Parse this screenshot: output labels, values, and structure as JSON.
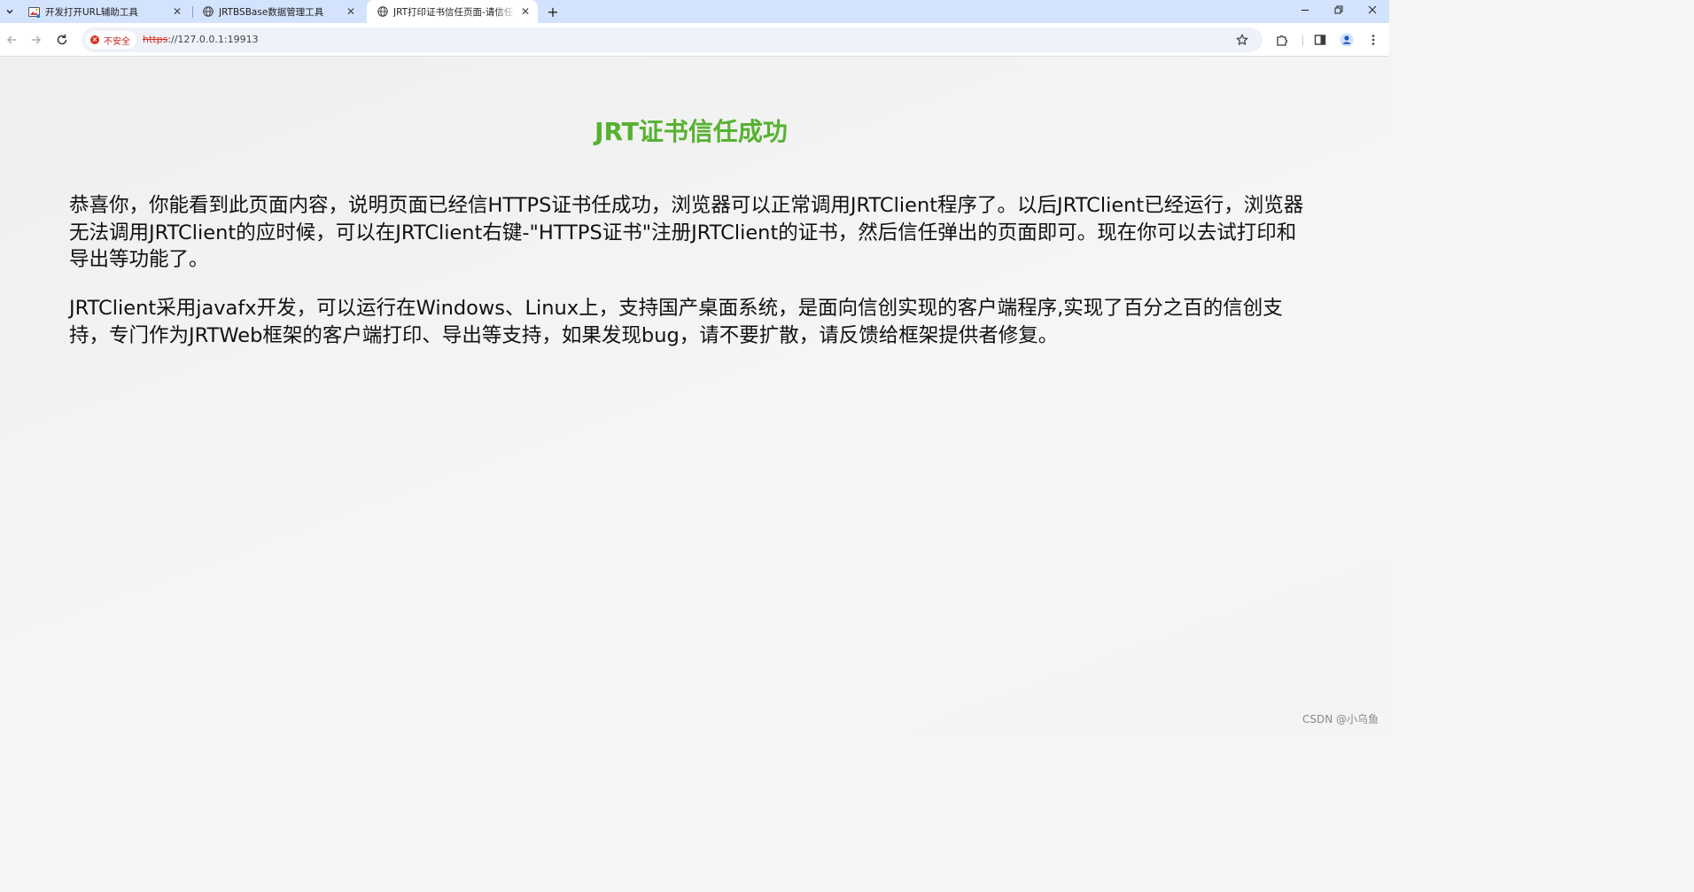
{
  "browser": {
    "tabs": [
      {
        "title": "开发打开URL辅助工具",
        "favicon": "image-icon",
        "active": false
      },
      {
        "title": "JRTBSBase数据管理工具",
        "favicon": "globe-icon",
        "active": false
      },
      {
        "title": "JRT打印证书信任页面-请信任此",
        "favicon": "globe-icon",
        "active": true
      }
    ],
    "security_label": "不安全",
    "url_scheme": "https",
    "url_rest": "://127.0.0.1:19913"
  },
  "page": {
    "title": "JRT证书信任成功",
    "paragraphs": [
      "恭喜你，你能看到此页面内容，说明页面已经信HTTPS证书任成功，浏览器可以正常调用JRTClient程序了。以后JRTClient已经运行，浏览器无法调用JRTClient的应时候，可以在JRTClient右键-\"HTTPS证书\"注册JRTClient的证书，然后信任弹出的页面即可。现在你可以去试打印和导出等功能了。",
      "JRTClient采用javafx开发，可以运行在Windows、Linux上，支持国产桌面系统，是面向信创实现的客户端程序,实现了百分之百的信创支持，专门作为JRTWeb框架的客户端打印、导出等支持，如果发现bug，请不要扩散，请反馈给框架提供者修复。"
    ],
    "title_color": "#56b230"
  },
  "watermark": "CSDN @小乌鱼"
}
